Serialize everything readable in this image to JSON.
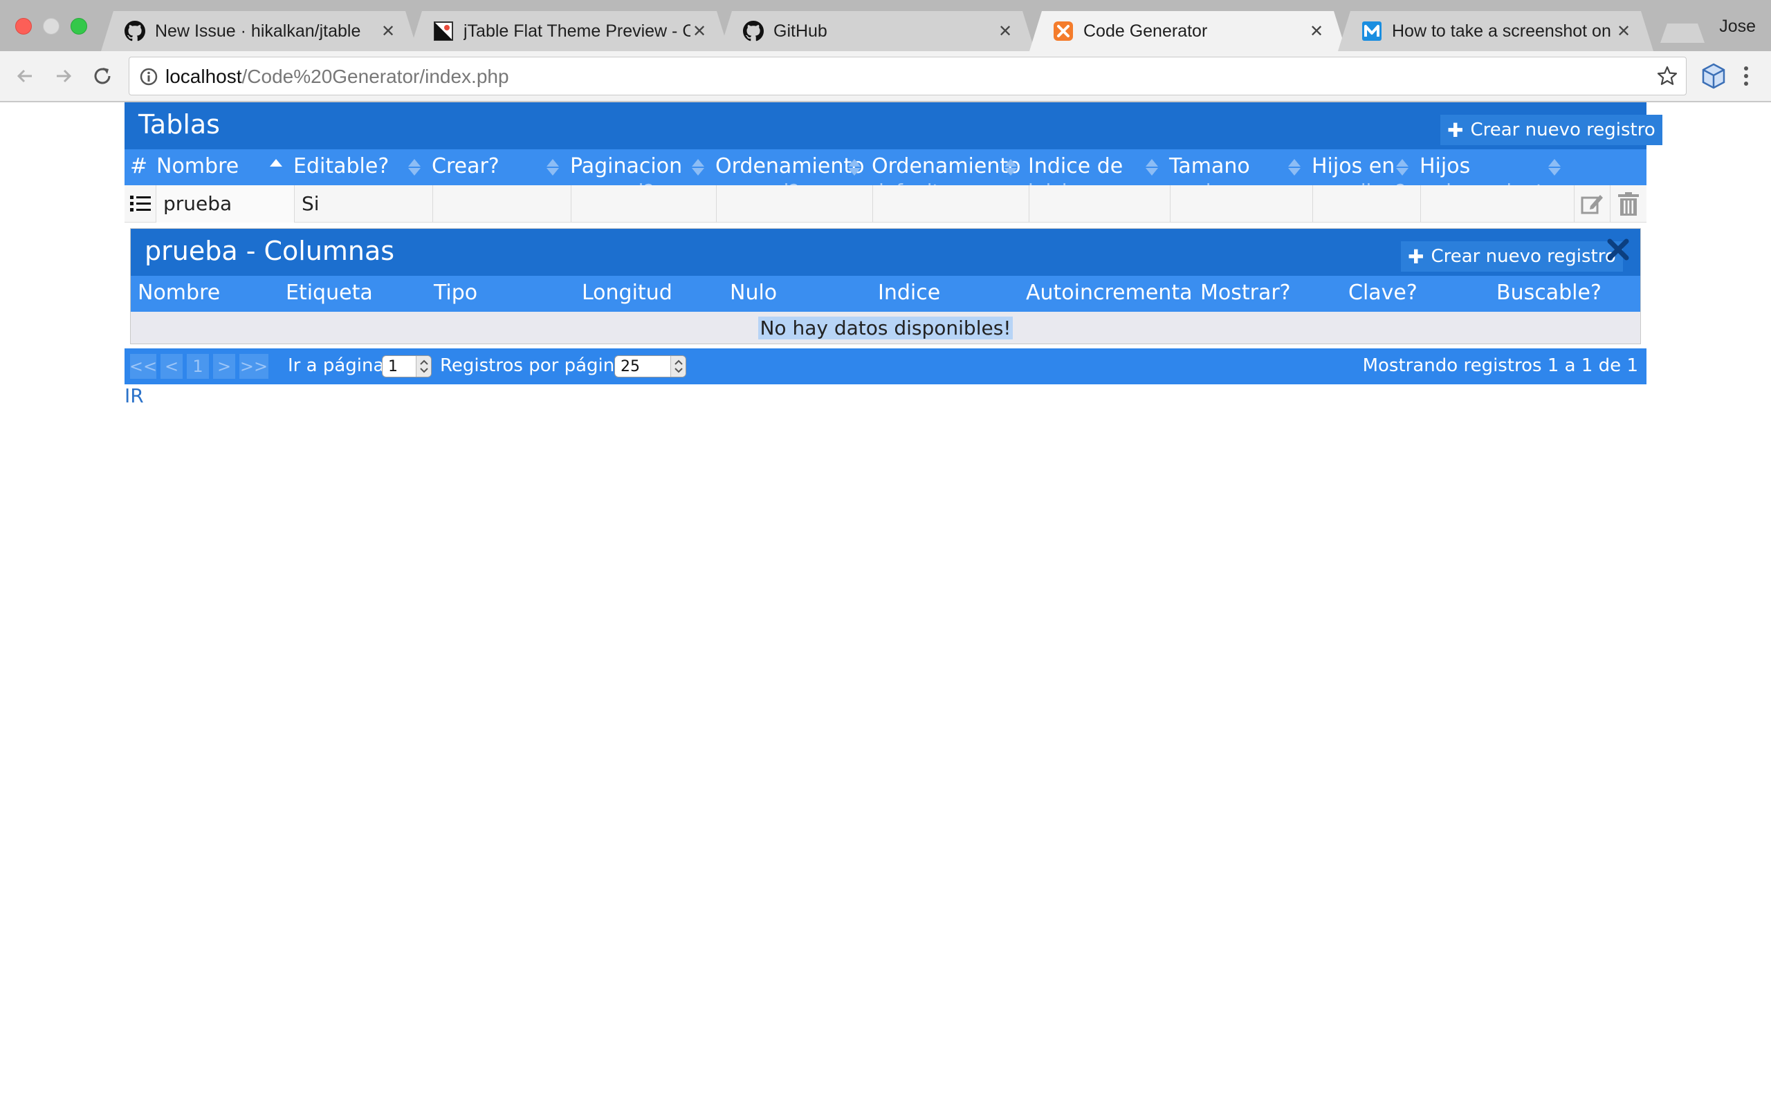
{
  "browser": {
    "profile_name": "Jose",
    "tabs": [
      {
        "title": "New Issue · hikalkan/jtable",
        "favicon": "github-icon",
        "active": false
      },
      {
        "title": "jTable Flat Theme Preview - C",
        "favicon": "jtable-icon",
        "active": false
      },
      {
        "title": "GitHub",
        "favicon": "github-icon",
        "active": false
      },
      {
        "title": "Code Generator",
        "favicon": "xampp-icon",
        "active": true
      },
      {
        "title": "How to take a screenshot on a",
        "favicon": "m-icon",
        "active": false
      }
    ],
    "url_host": "localhost",
    "url_path": "/Code%20Generator/index.php"
  },
  "tablas": {
    "title": "Tablas",
    "add_label": "Crear nuevo registro",
    "headers": [
      {
        "line1": "#",
        "line2": ""
      },
      {
        "line1": "Nombre",
        "line2": ""
      },
      {
        "line1": "Editable?",
        "line2": ""
      },
      {
        "line1": "Crear?",
        "line2": ""
      },
      {
        "line1": "Paginacion",
        "line2": "general?"
      },
      {
        "line1": "Ordenamiento",
        "line2": "general?"
      },
      {
        "line1": "Ordenamiento",
        "line2": "default"
      },
      {
        "line1": "Indice de",
        "line2": "inicio"
      },
      {
        "line1": "Tamano",
        "line2": "pagina"
      },
      {
        "line1": "Hijos en",
        "line2": "acordion?"
      },
      {
        "line1": "Hijos",
        "line2": "ordenamiento"
      }
    ],
    "rows": [
      {
        "nombre": "prueba",
        "editable": "Si",
        "crear": "",
        "paginacion": "",
        "ord_general": "",
        "ord_default": "",
        "indice": "",
        "tamano": "",
        "hijos_acordion": "",
        "hijos_orden": ""
      }
    ]
  },
  "columnas": {
    "title": "prueba - Columnas",
    "add_label": "Crear nuevo registro",
    "headers": [
      "Nombre",
      "Etiqueta",
      "Tipo",
      "Longitud",
      "Nulo",
      "Indice",
      "Autoincremental?",
      "Mostrar?",
      "Clave?",
      "Buscable?"
    ],
    "empty_message": "No hay datos disponibles!"
  },
  "footer": {
    "pager": [
      "<<",
      "<",
      "1",
      ">",
      ">>"
    ],
    "goto_label": "Ir a página:",
    "goto_value": "1",
    "page_size_label": "Registros por página:",
    "page_size_value": "25",
    "info": "Mostrando registros 1 a 1 de 1"
  },
  "ir_link": "IR",
  "colors": {
    "title_bar": "#1c6fcf",
    "header_bar": "#3a8ef0",
    "footer_bar": "#2f86ec",
    "link": "#2b72c9"
  }
}
